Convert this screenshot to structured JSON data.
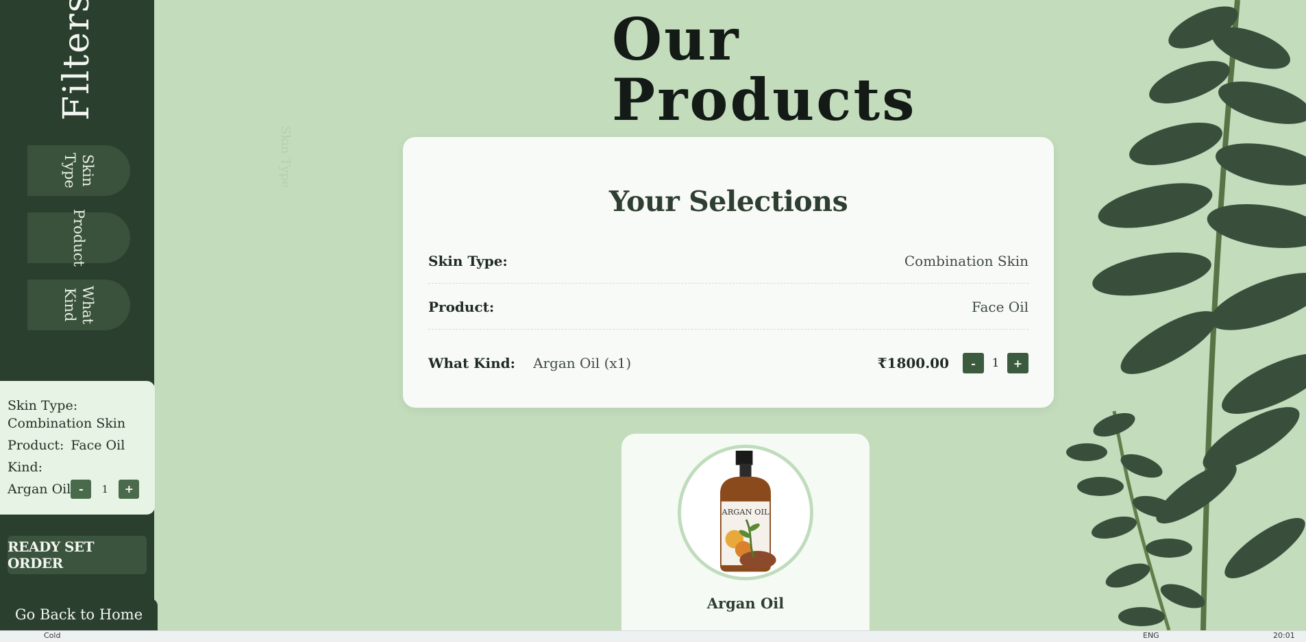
{
  "sidebar": {
    "title": "Filters",
    "buttons": [
      {
        "label": "Skin Type"
      },
      {
        "label": "Product"
      },
      {
        "label": "What Kind"
      }
    ],
    "summary": {
      "skin_type_label": "Skin Type:",
      "skin_type_value": "Combination Skin",
      "product_label": "Product:",
      "product_value": "Face Oil",
      "kind_label": "Kind:",
      "kind_item": "Argan Oil",
      "minus": "-",
      "qty": "1",
      "plus": "+"
    },
    "order_button": "READY SET ORDER",
    "home_link": "Go Back to Home"
  },
  "main": {
    "title_line1": "Our",
    "title_line2": "Products",
    "ghost_label": "Skin Type",
    "selections": {
      "heading": "Your Selections",
      "skin_type_label": "Skin Type:",
      "skin_type_value": "Combination Skin",
      "product_label": "Product:",
      "product_value": "Face Oil",
      "kind_label": "What Kind:",
      "kind_item": "Argan Oil (x1)",
      "price": "₹1800.00",
      "minus": "-",
      "qty": "1",
      "plus": "+"
    },
    "product_card": {
      "name": "Argan Oil",
      "bottle_label": "ARGAN OIL"
    }
  },
  "taskbar": {
    "left_text": "Cold",
    "lang": "ENG",
    "time": "20:01"
  },
  "colors": {
    "sidebar": "#2b3f2e",
    "background": "#c3dcbc",
    "accent_button": "#3b5a3e",
    "panel": "#f8faf7"
  }
}
